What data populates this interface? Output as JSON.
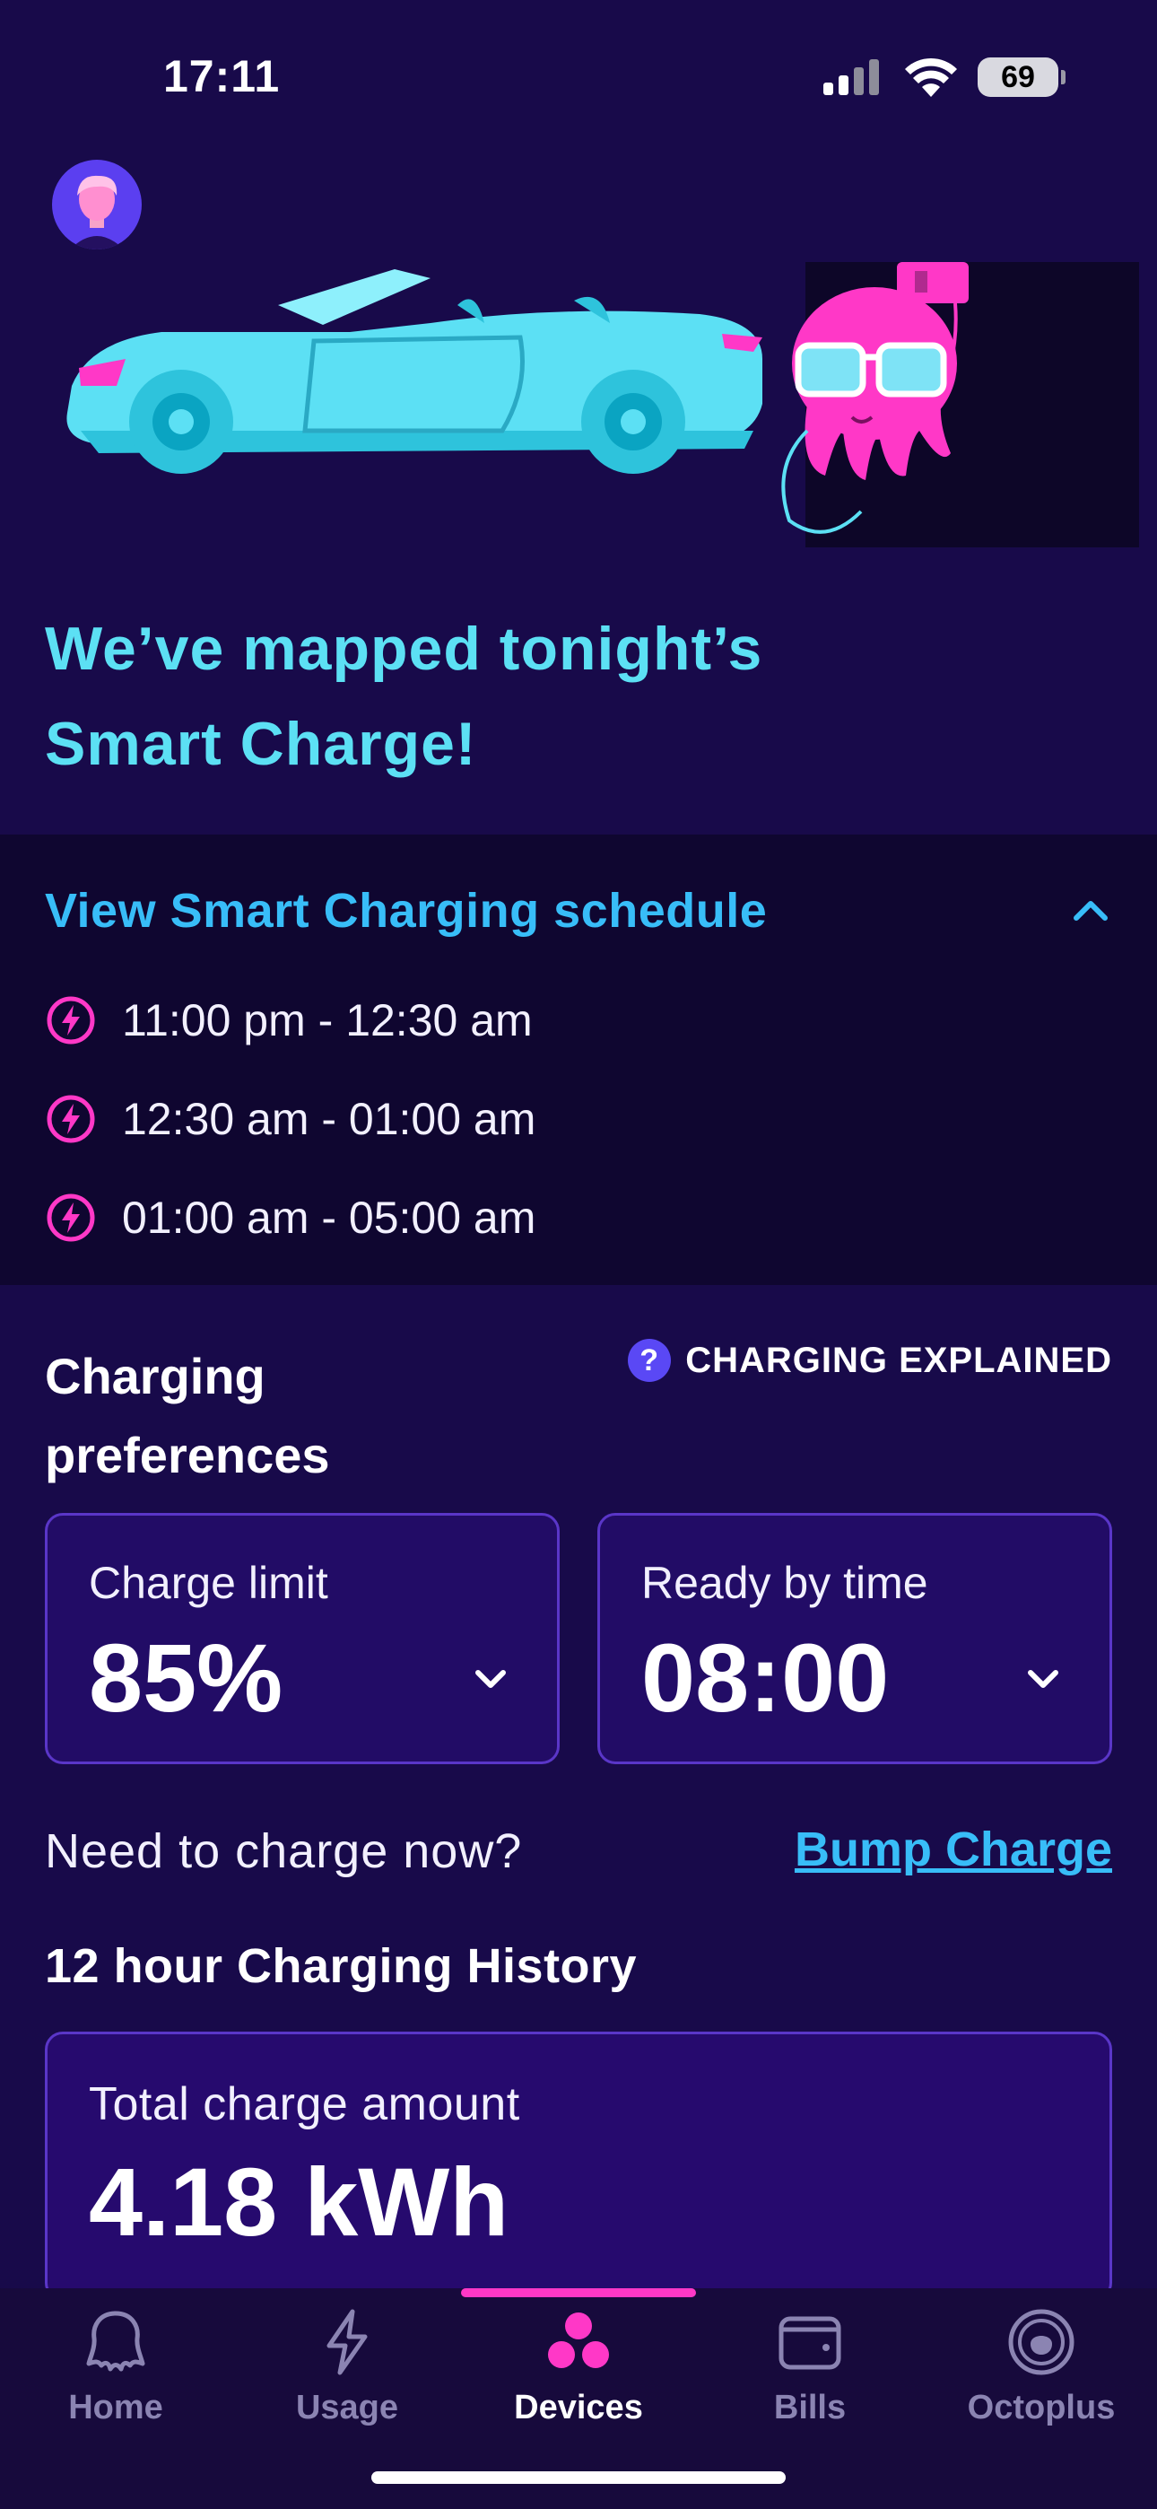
{
  "status_bar": {
    "time": "17:11",
    "battery": "69"
  },
  "headline": {
    "line1": "We’ve mapped tonight’s",
    "line2": "Smart Charge!"
  },
  "schedule": {
    "title": "View Smart Charging schedule",
    "slots": [
      "11:00 pm - 12:30 am",
      "12:30 am - 01:00 am",
      "01:00 am - 05:00 am"
    ]
  },
  "preferences": {
    "title": "Charging preferences",
    "help_badge": "?",
    "help_label": "CHARGING EXPLAINED",
    "charge_limit": {
      "label": "Charge limit",
      "value": "85%"
    },
    "ready_by": {
      "label": "Ready by time",
      "value": "08:00"
    }
  },
  "bump": {
    "prompt": "Need to charge now?",
    "link": "Bump Charge"
  },
  "history": {
    "title": "12 hour Charging History",
    "total_label": "Total charge amount",
    "total_value": "4.18 kWh"
  },
  "tabs": [
    {
      "label": "Home",
      "icon": "octopus-icon"
    },
    {
      "label": "Usage",
      "icon": "bolt-icon"
    },
    {
      "label": "Devices",
      "icon": "devices-icon",
      "active": true
    },
    {
      "label": "Bills",
      "icon": "wallet-icon"
    },
    {
      "label": "Octoplus",
      "icon": "octoplus-icon"
    }
  ],
  "colors": {
    "background": "#180a4a",
    "accent_cyan": "#5ce0f4",
    "link_blue": "#38bdf8",
    "accent_pink": "#ff38c7",
    "card_border": "#5a36c8"
  }
}
